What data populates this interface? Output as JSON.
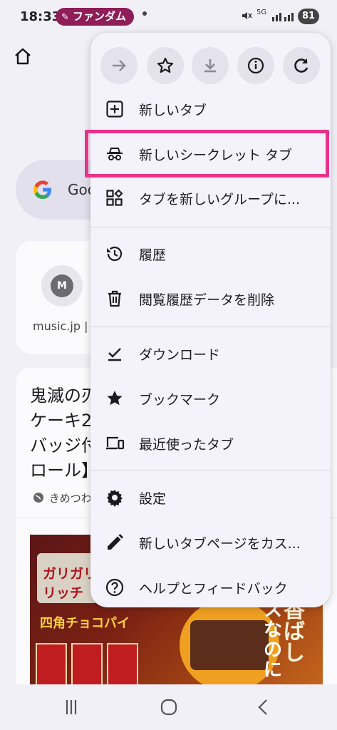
{
  "status_bar": {
    "time": "18:33",
    "notification_app": "ファンダム",
    "network": "5G",
    "battery": "81"
  },
  "background": {
    "search_text": "Goo",
    "shortcut_initial": "M",
    "shortcut_label": "music.jp | ...",
    "article_title": "鬼滅の刃\nケーキ2\nバッジ付\nロール】",
    "article_source": "きめつわ",
    "ad_brand": "ガリガリ",
    "ad_sub": "リッチ",
    "ad_product": "四角チョコパイ",
    "ad_side": "香ばし",
    "ad_side2": "スなのに"
  },
  "menu": {
    "toolbar": [
      {
        "name": "forward",
        "icon": "arrow-right-icon",
        "enabled": false
      },
      {
        "name": "bookmark",
        "icon": "star-outline-icon",
        "enabled": true
      },
      {
        "name": "download",
        "icon": "download-icon",
        "enabled": false
      },
      {
        "name": "page-info",
        "icon": "info-icon",
        "enabled": true
      },
      {
        "name": "reload",
        "icon": "refresh-icon",
        "enabled": true
      }
    ],
    "items": [
      {
        "label": "新しいタブ",
        "icon": "add-box-icon"
      },
      {
        "label": "新しいシークレット タブ",
        "icon": "incognito-icon"
      },
      {
        "label": "タブを新しいグループに...",
        "icon": "tab-group-icon"
      },
      {
        "label": "履歴",
        "icon": "history-icon"
      },
      {
        "label": "閲覧履歴データを削除",
        "icon": "trash-icon"
      },
      {
        "label": "ダウンロード",
        "icon": "download-done-icon"
      },
      {
        "label": "ブックマーク",
        "icon": "star-filled-icon"
      },
      {
        "label": "最近使ったタブ",
        "icon": "devices-icon"
      },
      {
        "label": "設定",
        "icon": "settings-icon"
      },
      {
        "label": "新しいタブページをカス...",
        "icon": "edit-icon"
      },
      {
        "label": "ヘルプとフィードバック",
        "icon": "help-icon"
      }
    ],
    "highlighted_item": "新しいシークレット タブ",
    "highlight_color": "#e8338b"
  },
  "colors": {
    "pill": "#8e1d58",
    "menu_bg": "#f4f2fa",
    "page_bg": "#f1f0f7"
  }
}
